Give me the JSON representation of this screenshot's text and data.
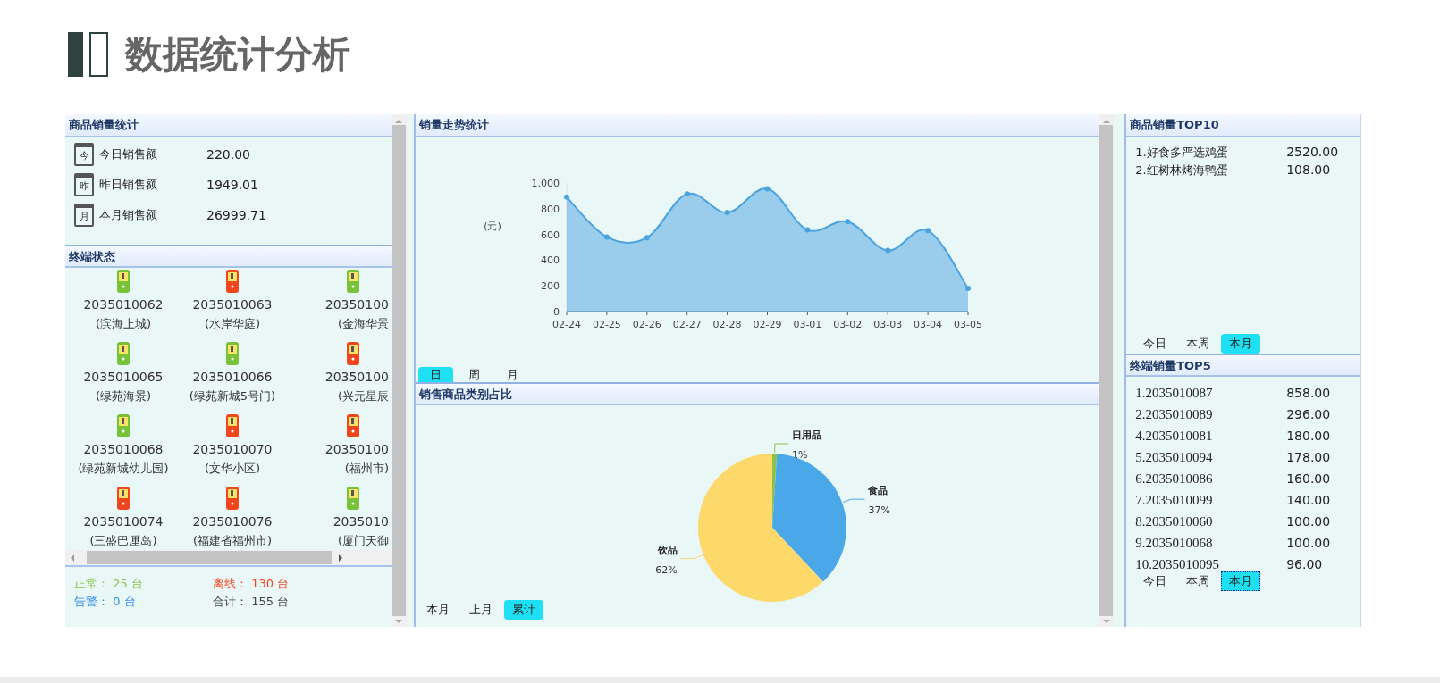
{
  "page_title": "数据统计分析",
  "sales_summary": {
    "title": "商品销量统计",
    "rows": [
      {
        "icon_text": "今",
        "label": "今日销售额",
        "value": "220.00"
      },
      {
        "icon_text": "昨",
        "label": "昨日销售额",
        "value": "1949.01"
      },
      {
        "icon_text": "月",
        "label": "本月销售额",
        "value": "26999.71"
      }
    ]
  },
  "terminal_status": {
    "title": "终端状态",
    "terminals": [
      {
        "id": "2035010062",
        "name": "(滨海上城)",
        "color": "#78c23a"
      },
      {
        "id": "2035010063",
        "name": "(水岸华庭)",
        "color": "#f0461e"
      },
      {
        "id": "20350100",
        "name": "(金海华景",
        "color": "#78c23a"
      },
      {
        "id": "2035010065",
        "name": "(绿苑海景)",
        "color": "#78c23a"
      },
      {
        "id": "2035010066",
        "name": "(绿苑新城5号门)",
        "color": "#78c23a"
      },
      {
        "id": "20350100",
        "name": "(兴元星辰",
        "color": "#f0461e"
      },
      {
        "id": "2035010068",
        "name": "(绿苑新城幼儿园)",
        "color": "#78c23a"
      },
      {
        "id": "2035010070",
        "name": "(文华小区)",
        "color": "#f0461e"
      },
      {
        "id": "20350100",
        "name": "(福州市)",
        "color": "#f0461e"
      },
      {
        "id": "2035010074",
        "name": "(三盛巴厘岛)",
        "color": "#f0461e"
      },
      {
        "id": "2035010076",
        "name": "(福建省福州市)",
        "color": "#f0461e"
      },
      {
        "id": "2035010",
        "name": "(厦门天御",
        "color": "#78c23a"
      }
    ],
    "totals": [
      {
        "kind": "normal",
        "text": "正常： 25 台"
      },
      {
        "kind": "offline",
        "text": "离线： 130 台"
      },
      {
        "kind": "alarm",
        "text": "告警： 0 台"
      },
      {
        "kind": "total",
        "text": "合计： 155 台"
      }
    ]
  },
  "sales_trend": {
    "title": "销量走势统计",
    "chart_data": {
      "type": "area",
      "ylabel": "(元)",
      "categories": [
        "02-24",
        "02-25",
        "02-26",
        "02-27",
        "02-28",
        "02-29",
        "03-01",
        "03-02",
        "03-03",
        "03-04",
        "03-05"
      ],
      "series": [
        {
          "color": "#4aa3df",
          "values": [
            890,
            580,
            575,
            915,
            770,
            955,
            635,
            700,
            475,
            630,
            180
          ]
        }
      ],
      "ylim": [
        0,
        1000
      ],
      "yticks": [
        0,
        200,
        400,
        600,
        800,
        {
          "value": 1000,
          "label": "1,000"
        }
      ]
    },
    "tabs": [
      {
        "label": "日",
        "selected": true
      },
      {
        "label": "周",
        "selected": false
      },
      {
        "label": "月",
        "selected": false
      }
    ]
  },
  "category_share": {
    "title": "销售商品类别占比",
    "chart_data": {
      "type": "pie",
      "categories": [
        "日用品",
        "食品",
        "饮品"
      ],
      "series": [
        {
          "values": [
            1,
            37,
            62
          ]
        }
      ],
      "value_labels": [
        "1%",
        "37%",
        "62%"
      ]
    },
    "tabs": [
      {
        "label": "本月",
        "selected": false
      },
      {
        "label": "上月",
        "selected": false
      },
      {
        "label": "累计",
        "selected": true
      }
    ]
  },
  "product_top10": {
    "title": "商品销量TOP10",
    "rows": [
      {
        "name": "1.好食多严选鸡蛋",
        "value": "2520.00"
      },
      {
        "name": "2.红树林烤海鸭蛋",
        "value": "108.00"
      }
    ],
    "tabs": [
      {
        "label": "今日",
        "selected": false
      },
      {
        "label": "本周",
        "selected": false
      },
      {
        "label": "本月",
        "selected": true
      }
    ]
  },
  "terminal_top5": {
    "title": "终端销量TOP5",
    "rows": [
      {
        "name": "1.2035010087",
        "value": "858.00"
      },
      {
        "name": "2.2035010089",
        "value": "296.00"
      },
      {
        "name": "4.2035010081",
        "value": "180.00"
      },
      {
        "name": "5.2035010094",
        "value": "178.00"
      },
      {
        "name": "6.2035010086",
        "value": "160.00"
      },
      {
        "name": "7.2035010099",
        "value": "140.00"
      },
      {
        "name": "8.2035010060",
        "value": "100.00"
      },
      {
        "name": "9.2035010068",
        "value": "100.00"
      },
      {
        "name": "10.2035010095",
        "value": "96.00"
      }
    ],
    "tabs": [
      {
        "label": "今日",
        "selected": false,
        "focused": false
      },
      {
        "label": "本周",
        "selected": false,
        "focused": false
      },
      {
        "label": "本月",
        "selected": true,
        "focused": true
      }
    ]
  }
}
